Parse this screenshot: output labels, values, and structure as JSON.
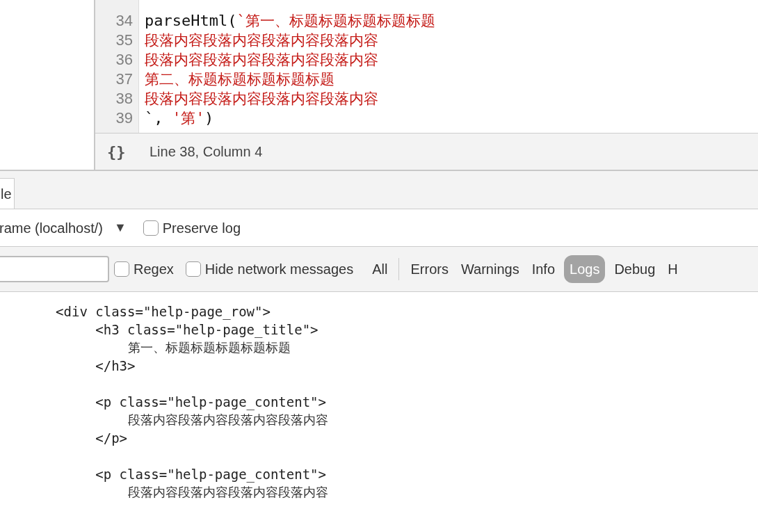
{
  "editor": {
    "lines": [
      {
        "number": "34",
        "segments": [
          {
            "text": "parseHtml(",
            "kind": "plain"
          },
          {
            "text": "`第一、标题标题标题标题标题",
            "kind": "string"
          }
        ]
      },
      {
        "number": "35",
        "segments": [
          {
            "text": "段落内容段落内容段落内容段落内容",
            "kind": "string"
          }
        ]
      },
      {
        "number": "36",
        "segments": [
          {
            "text": "段落内容段落内容段落内容段落内容",
            "kind": "string"
          }
        ]
      },
      {
        "number": "37",
        "segments": [
          {
            "text": "第二、标题标题标题标题标题",
            "kind": "string"
          }
        ]
      },
      {
        "number": "38",
        "segments": [
          {
            "text": "段落内容段落内容段落内容段落内容",
            "kind": "string"
          }
        ]
      },
      {
        "number": "39",
        "segments": [
          {
            "text": "`, ",
            "kind": "plain"
          },
          {
            "text": "'第'",
            "kind": "string"
          },
          {
            "text": ")",
            "kind": "plain"
          }
        ]
      }
    ],
    "status": {
      "format_icon": "{}",
      "position": "Line 38, Column 4"
    }
  },
  "drawer_tabs": [
    {
      "label": "le",
      "selected": true
    }
  ],
  "context": {
    "label": "rame (localhost/)",
    "caret": "▼",
    "preserve_log": {
      "label": "Preserve log",
      "checked": false
    }
  },
  "filter": {
    "regex": {
      "label": "Regex",
      "checked": false
    },
    "hide_network": {
      "label": "Hide network messages",
      "checked": false
    },
    "levels": [
      {
        "label": "All",
        "selected": false
      },
      {
        "label": "Errors",
        "selected": false
      },
      {
        "label": "Warnings",
        "selected": false
      },
      {
        "label": "Info",
        "selected": false
      },
      {
        "label": "Logs",
        "selected": true
      },
      {
        "label": "Debug",
        "selected": false
      },
      {
        "label": "H",
        "selected": false
      }
    ]
  },
  "console": {
    "blocks": [
      [
        {
          "text": "       <div class=\"help-page_row\">",
          "kind": "markup"
        },
        {
          "text": "            <h3 class=\"help-page_title\">",
          "kind": "markup"
        },
        {
          "text": "                 第一、标题标题标题标题标题",
          "kind": "text"
        },
        {
          "text": "            </h3>",
          "kind": "markup"
        }
      ],
      [
        {
          "text": "            <p class=\"help-page_content\">",
          "kind": "markup"
        },
        {
          "text": "                 段落内容段落内容段落内容段落内容",
          "kind": "text"
        },
        {
          "text": "            </p>",
          "kind": "markup"
        }
      ],
      [
        {
          "text": "            <p class=\"help-page_content\">",
          "kind": "markup"
        },
        {
          "text": "                 段落内容段落内容段落内容段落内容",
          "kind": "text"
        }
      ]
    ]
  }
}
